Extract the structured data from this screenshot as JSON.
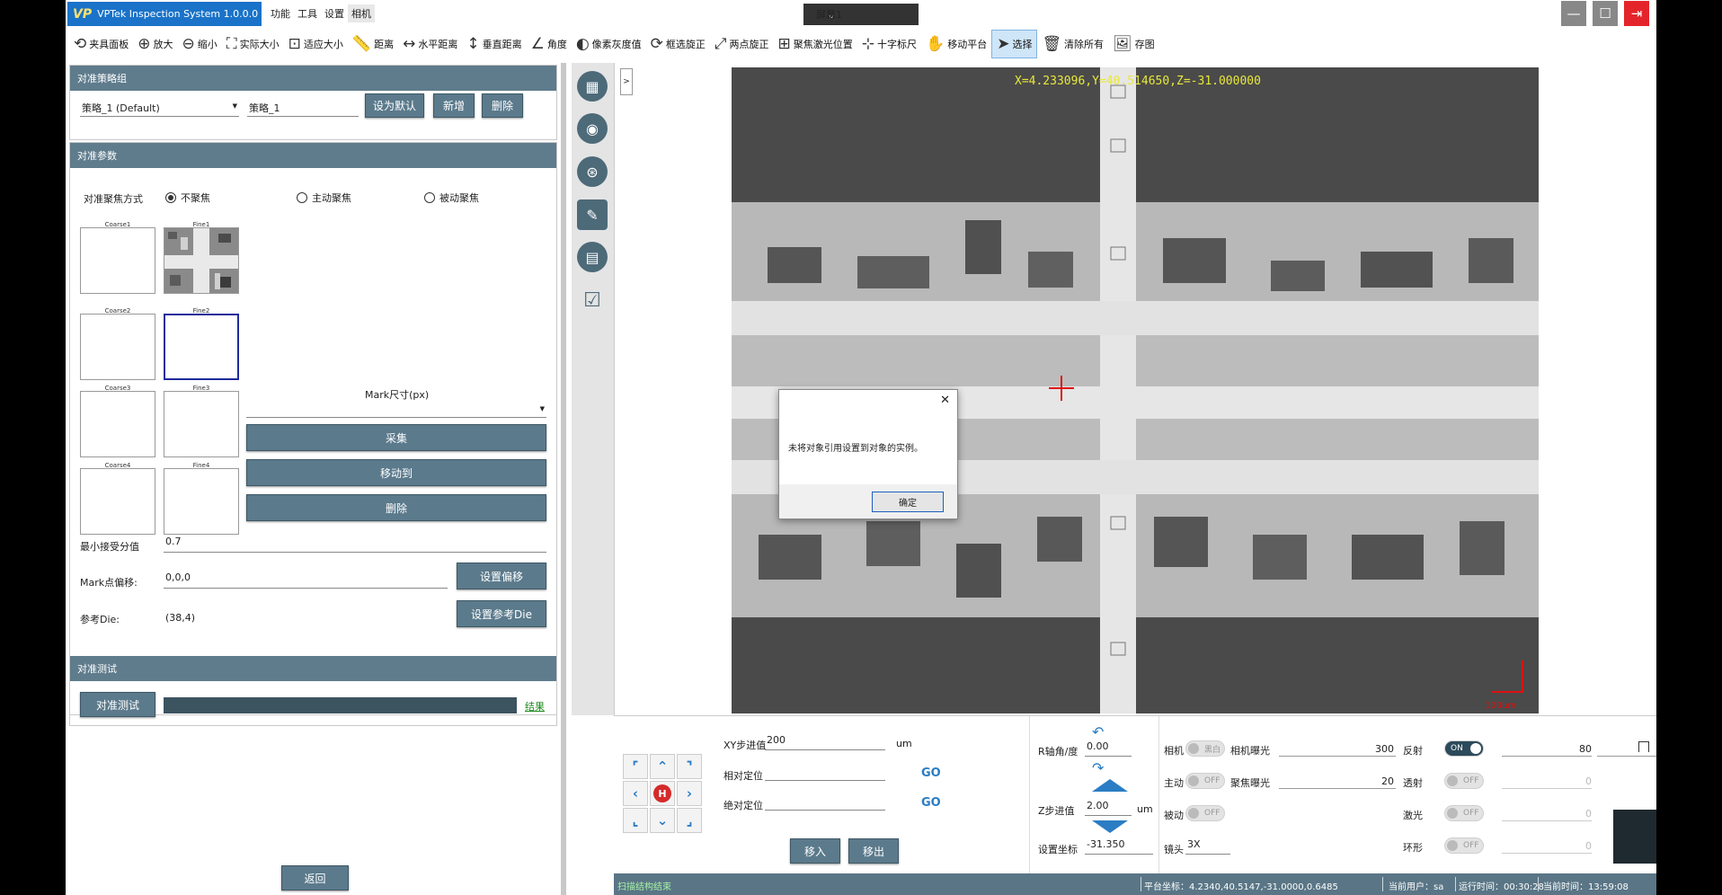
{
  "app": {
    "name": "VPTek Inspection System 1.0.0.0",
    "menus": [
      "功能",
      "工具",
      "设置",
      "相机"
    ],
    "screen_select": "屏幕1"
  },
  "toolbar": {
    "items": [
      {
        "label": "夹具面板",
        "icon": "fixture-icon"
      },
      {
        "label": "放大",
        "icon": "zoom-in-icon"
      },
      {
        "label": "缩小",
        "icon": "zoom-out-icon"
      },
      {
        "label": "实际大小",
        "icon": "actual-size-icon"
      },
      {
        "label": "适应大小",
        "icon": "fit-size-icon"
      },
      {
        "label": "距离",
        "icon": "ruler-icon"
      },
      {
        "label": "水平距离",
        "icon": "horizontal-distance-icon"
      },
      {
        "label": "垂直距离",
        "icon": "vertical-distance-icon"
      },
      {
        "label": "角度",
        "icon": "angle-icon"
      },
      {
        "label": "像素灰度值",
        "icon": "grayscale-icon"
      },
      {
        "label": "框选旋正",
        "icon": "rotate-box-icon"
      },
      {
        "label": "两点旋正",
        "icon": "two-point-rotate-icon"
      },
      {
        "label": "聚焦激光位置",
        "icon": "laser-focus-icon"
      },
      {
        "label": "十字标尺",
        "icon": "crosshair-ruler-icon"
      },
      {
        "label": "移动平台",
        "icon": "hand-move-icon"
      },
      {
        "label": "选择",
        "icon": "cursor-icon"
      },
      {
        "label": "清除所有",
        "icon": "trash-icon"
      },
      {
        "label": "存图",
        "icon": "save-image-icon"
      }
    ],
    "active": "选择"
  },
  "strategy_group": {
    "header": "对准策略组",
    "selected": "策略_1 (Default)",
    "name_value": "策略_1",
    "set_default": "设为默认",
    "add": "新增",
    "delete": "删除"
  },
  "params": {
    "header": "对准参数",
    "focus_mode_label": "对准聚焦方式",
    "focus_options": [
      "不聚焦",
      "主动聚焦",
      "被动聚焦"
    ],
    "focus_selected": "不聚焦",
    "thumb_labels": [
      "Coarse1",
      "Fine1",
      "Coarse2",
      "Fine2",
      "Coarse3",
      "Fine3",
      "Coarse4",
      "Fine4"
    ],
    "mark_size_label": "Mark尺寸(px)",
    "collect": "采集",
    "move_to": "移动到",
    "delete": "删除",
    "min_accept_label": "最小接受分值",
    "min_accept_value": "0.7",
    "mark_offset_label": "Mark点偏移:",
    "mark_offset_value": "0,0,0",
    "set_offset": "设置偏移",
    "ref_die_label": "参考Die:",
    "ref_die_value": "(38,4)",
    "set_ref_die": "设置参考Die"
  },
  "test": {
    "header": "对准测试",
    "run": "对准测试",
    "result": "结果"
  },
  "back": "返回",
  "viewer": {
    "expander": ">",
    "coords": "X=4.233096,Y=40.514650,Z=-31.000000",
    "scale_label": "100um"
  },
  "dialog": {
    "message": "未将对象引用设置到对象的实例。",
    "ok": "确定"
  },
  "motion": {
    "xy_step_label": "XY步进值",
    "xy_step_value": "200",
    "xy_unit": "um",
    "rel_pos_label": "相对定位",
    "abs_pos_label": "绝对定位",
    "go": "GO",
    "move_in": "移入",
    "move_out": "移出",
    "r_angle_label": "R轴角/度",
    "r_angle_value": "0.00",
    "z_step_label": "Z步进值",
    "z_step_value": "2.00",
    "z_unit": "um",
    "set_coord_label": "设置坐标",
    "set_coord_value": "-31.350"
  },
  "lighting": {
    "camera_label": "相机",
    "camera_toggle": "黑白",
    "camera_exposure_label": "相机曝光",
    "camera_exposure_value": "300",
    "active_label": "主动",
    "active_toggle": "OFF",
    "focus_exposure_label": "聚焦曝光",
    "focus_exposure_value": "20",
    "passive_label": "被动",
    "passive_toggle": "OFF",
    "lens_label": "镜头",
    "lens_value": "3X",
    "reflect_label": "反射",
    "reflect_toggle": "ON",
    "reflect_value": "80",
    "transmit_label": "透射",
    "transmit_toggle": "OFF",
    "transmit_value": "0",
    "laser_label": "激光",
    "laser_toggle": "OFF",
    "laser_value": "0",
    "ring_label": "环形",
    "ring_toggle": "OFF",
    "ring_value": "0"
  },
  "status": {
    "message": "扫描结构结束",
    "platform": "平台坐标：4.2340,40.5147,-31.0000,0.6485",
    "user": "当前用户：sa",
    "runtime": "运行时间：00:30:28",
    "clock": "当前时间：13:59:08"
  }
}
